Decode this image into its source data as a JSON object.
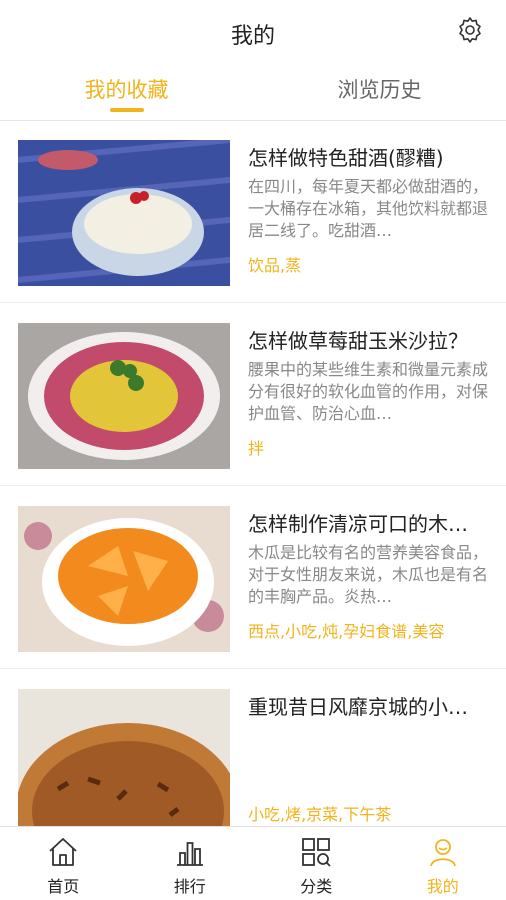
{
  "header": {
    "title": "我的"
  },
  "tabs": [
    {
      "label": "我的收藏",
      "active": true
    },
    {
      "label": "浏览历史",
      "active": false
    }
  ],
  "colors": {
    "accent": "#f2b31b"
  },
  "recipes": [
    {
      "title": "怎样做特色甜酒(醪糟)",
      "description": "在四川，每年夏天都必做甜酒的，一大桶存在冰箱，其他饮料就都退居二线了。吃甜酒…",
      "tags": "饮品,蒸"
    },
    {
      "title": "怎样做草莓甜玉米沙拉？",
      "description": "腰果中的某些维生素和微量元素成分有很好的软化血管的作用，对保护血管、防治心血…",
      "tags": "拌"
    },
    {
      "title": "怎样制作清凉可口的木…",
      "description": "木瓜是比较有名的营养美容食品，对于女性朋友来说，木瓜也是有名的丰胸产品。炎热…",
      "tags": "西点,小吃,炖,孕妇食谱,美容"
    },
    {
      "title": "重现昔日风靡京城的小…",
      "description": "",
      "tags": "小吃,烤,京菜,下午茶"
    }
  ],
  "nav": [
    {
      "label": "首页",
      "icon": "home-icon"
    },
    {
      "label": "排行",
      "icon": "ranking-icon"
    },
    {
      "label": "分类",
      "icon": "category-icon"
    },
    {
      "label": "我的",
      "icon": "profile-icon",
      "active": true
    }
  ]
}
